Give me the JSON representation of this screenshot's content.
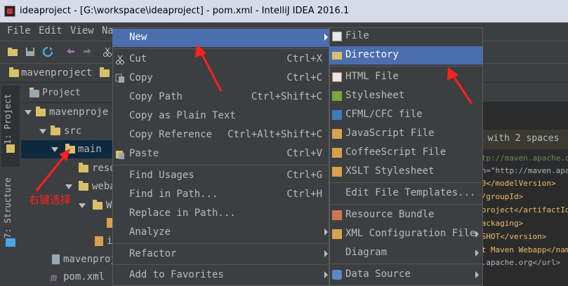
{
  "window": {
    "title": "ideaproject - [G:\\workspace\\ideaproject] - pom.xml - IntelliJ IDEA 2016.1"
  },
  "menubar": [
    "File",
    "Edit",
    "View",
    "Na"
  ],
  "breadcrumb": {
    "project": "mavenproject"
  },
  "tool_stripe": {
    "project_tab": "1: Project",
    "structure_tab": "7: Structure"
  },
  "project_panel": {
    "header": "Project",
    "tree": [
      {
        "label": "mavenproje",
        "level": 0
      },
      {
        "label": "src",
        "level": 1
      },
      {
        "label": "main",
        "level": 2,
        "selected": true
      },
      {
        "label": "reso",
        "level": 3
      },
      {
        "label": "weba",
        "level": 3
      },
      {
        "label": "W",
        "level": 4
      },
      {
        "label": "",
        "level": 5
      },
      {
        "label": "i",
        "level": 5
      },
      {
        "label": "mavenproj",
        "level": 1
      },
      {
        "label": "pom.xml",
        "level": 1
      }
    ]
  },
  "context_menu": {
    "items": [
      {
        "label": "New",
        "shortcut": "",
        "submenu": true,
        "highlighted": true
      },
      {
        "label": "Cut",
        "shortcut": "Ctrl+X"
      },
      {
        "label": "Copy",
        "shortcut": "Ctrl+C"
      },
      {
        "label": "Copy Path",
        "shortcut": "Ctrl+Shift+C"
      },
      {
        "label": "Copy as Plain Text",
        "shortcut": ""
      },
      {
        "label": "Copy Reference",
        "shortcut": "Ctrl+Alt+Shift+C"
      },
      {
        "label": "Paste",
        "shortcut": "Ctrl+V"
      },
      {
        "label": "Find Usages",
        "shortcut": "Ctrl+G"
      },
      {
        "label": "Find in Path...",
        "shortcut": "Ctrl+H"
      },
      {
        "label": "Replace in Path...",
        "shortcut": ""
      },
      {
        "label": "Analyze",
        "shortcut": "",
        "submenu": true
      },
      {
        "label": "Refactor",
        "shortcut": "",
        "submenu": true
      },
      {
        "label": "Add to Favorites",
        "shortcut": "",
        "submenu": true
      }
    ]
  },
  "new_submenu": {
    "items": [
      {
        "label": "File",
        "icon": "file-icon"
      },
      {
        "label": "Directory",
        "icon": "folder-icon",
        "highlighted": true
      },
      {
        "label": "HTML File",
        "icon": "html-file-icon"
      },
      {
        "label": "Stylesheet",
        "icon": "css-file-icon"
      },
      {
        "label": "CFML/CFC file",
        "icon": "cfml-file-icon"
      },
      {
        "label": "JavaScript File",
        "icon": "javascript-file-icon"
      },
      {
        "label": "CoffeeScript File",
        "icon": "coffeescript-file-icon"
      },
      {
        "label": "XSLT Stylesheet",
        "icon": "xslt-file-icon"
      },
      {
        "label": "Edit File Templates...",
        "icon": ""
      },
      {
        "label": "Resource Bundle",
        "icon": "resource-bundle-icon"
      },
      {
        "label": "XML Configuration File",
        "icon": "xml-config-icon",
        "submenu": true
      },
      {
        "label": "Diagram",
        "icon": "",
        "submenu": true
      },
      {
        "label": "Data Source",
        "icon": "data-source-icon",
        "submenu": true
      }
    ]
  },
  "editor_fragments": [
    "d with 2 spaces",
    "ttp://maven.apache.org",
    "on=\"http://maven.apache",
    ".0</modelVersion>",
    "</groupId>",
    "nproject</artifactId>",
    "packaging>",
    "PSHOT</version>",
    "ct Maven Webapp</name",
    "n.apache.org</url>"
  ],
  "annotation": {
    "text": "右键选择"
  },
  "colors": {
    "menu_highlight": "#4b6eaf",
    "annotation": "#ff2020",
    "folder": "#d8c06a"
  }
}
